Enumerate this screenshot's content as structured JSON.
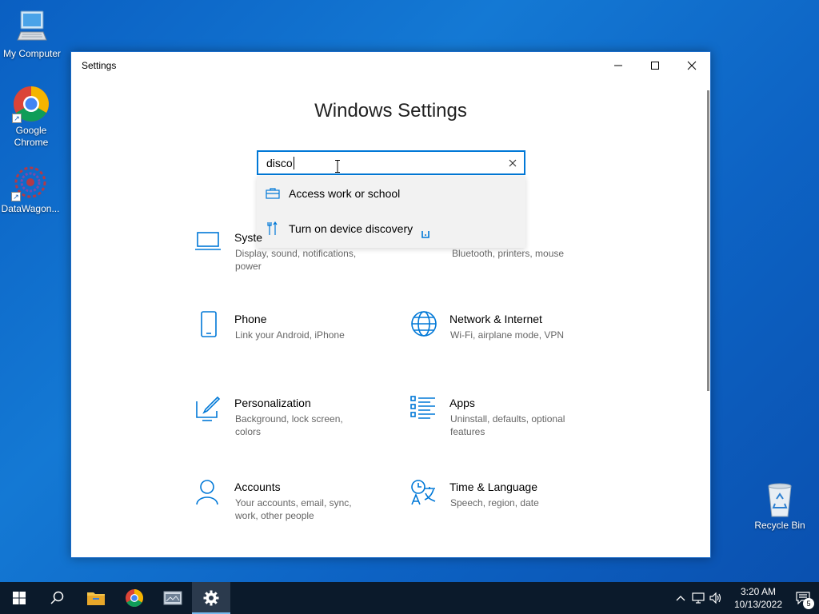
{
  "desktop": {
    "icons": [
      {
        "label": "My Computer"
      },
      {
        "label": "Google Chrome"
      },
      {
        "label": "DataWagon..."
      },
      {
        "label": "Recycle Bin"
      }
    ]
  },
  "window": {
    "title": "Settings",
    "heading": "Windows Settings",
    "search": {
      "value": "disco",
      "suggestions": [
        {
          "label": "Access work or school",
          "icon": "briefcase-icon"
        },
        {
          "label": "Turn on device discovery",
          "icon": "tools-icon"
        }
      ]
    },
    "tiles": [
      {
        "title": "Syste",
        "desc": "Display, sound, notifications, power",
        "icon": "laptop-icon"
      },
      {
        "title": "",
        "desc": "Bluetooth, printers, mouse",
        "icon": "devices-icon"
      },
      {
        "title": "Phone",
        "desc": "Link your Android, iPhone",
        "icon": "phone-icon"
      },
      {
        "title": "Network & Internet",
        "desc": "Wi-Fi, airplane mode, VPN",
        "icon": "globe-icon"
      },
      {
        "title": "Personalization",
        "desc": "Background, lock screen, colors",
        "icon": "paintbrush-icon"
      },
      {
        "title": "Apps",
        "desc": "Uninstall, defaults, optional features",
        "icon": "apps-list-icon"
      },
      {
        "title": "Accounts",
        "desc": "Your accounts, email, sync, work, other people",
        "icon": "person-icon"
      },
      {
        "title": "Time & Language",
        "desc": "Speech, region, date",
        "icon": "time-language-icon"
      }
    ]
  },
  "taskbar": {
    "time": "3:20 AM",
    "date": "10/13/2022",
    "notification_count": "5"
  },
  "colors": {
    "accent": "#0078d7",
    "desktop": "#0d63c4",
    "taskbar": "#0b1a2b"
  }
}
